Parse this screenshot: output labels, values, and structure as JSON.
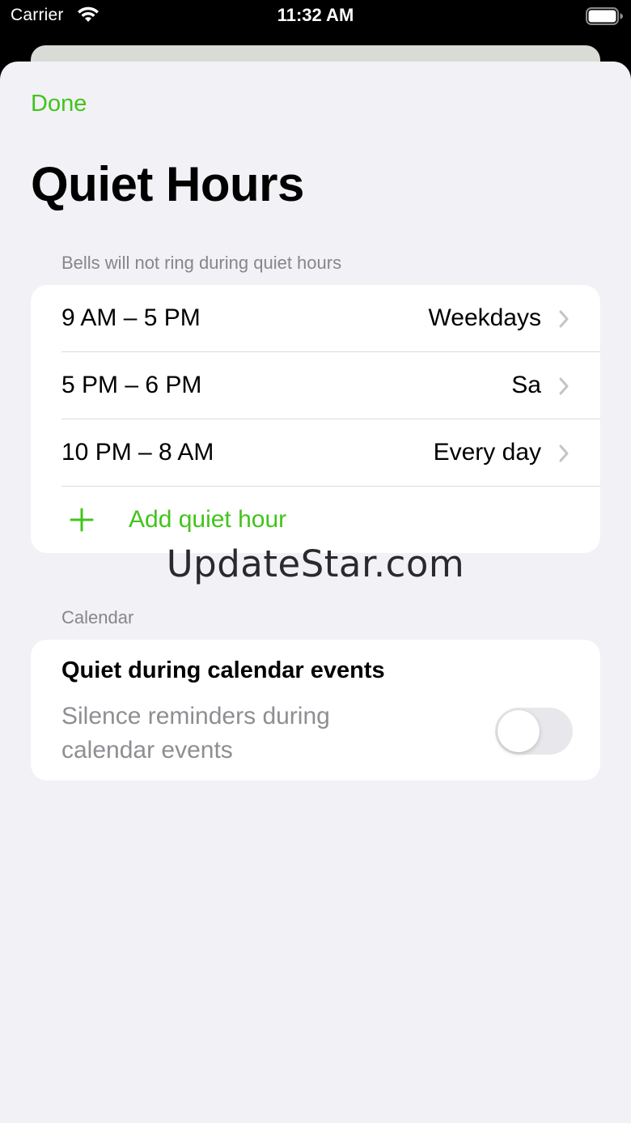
{
  "status_bar": {
    "carrier": "Carrier",
    "time": "11:32 AM",
    "wifi_icon": "wifi-icon",
    "battery_icon": "battery-icon"
  },
  "nav": {
    "done_label": "Done"
  },
  "page": {
    "title": "Quiet Hours"
  },
  "quiet_hours": {
    "header": "Bells will not ring during quiet hours",
    "items": [
      {
        "time": "9 AM – 5 PM",
        "days": "Weekdays"
      },
      {
        "time": "5 PM – 6 PM",
        "days": "Sa"
      },
      {
        "time": "10 PM – 8 AM",
        "days": "Every day"
      }
    ],
    "add_label": "Add quiet hour",
    "add_icon": "plus-icon"
  },
  "calendar": {
    "header": "Calendar",
    "title": "Quiet during calendar events",
    "subtitle": "Silence reminders during calendar events",
    "toggle_on": false
  },
  "watermark": "UpdateStar.com",
  "colors": {
    "accent": "#41c41b",
    "background": "#f1f1f6",
    "card": "#ffffff",
    "secondary_text": "#86868b"
  }
}
